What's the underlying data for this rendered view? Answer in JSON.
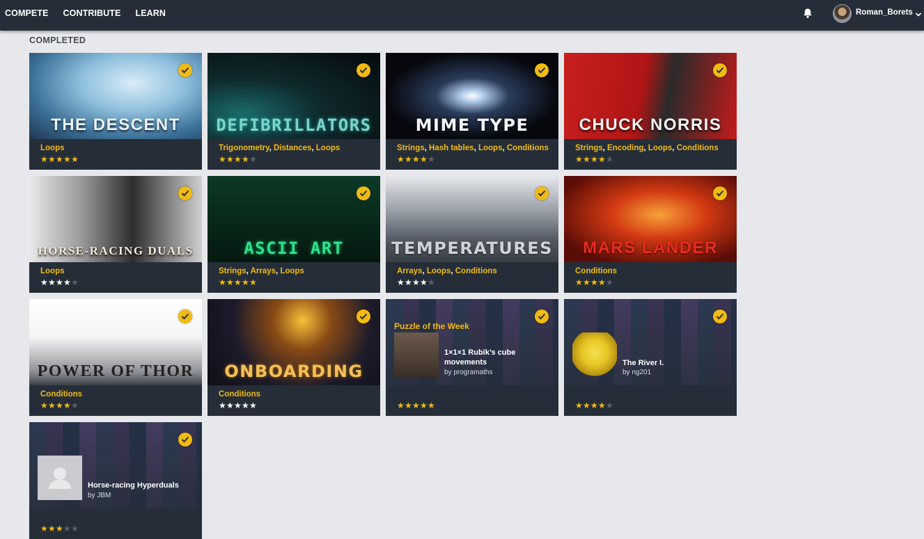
{
  "nav": {
    "items": [
      "COMPETE",
      "CONTRIBUTE",
      "LEARN"
    ]
  },
  "user": {
    "name": "Roman_Borets"
  },
  "section": {
    "title": "COMPLETED"
  },
  "icons": {
    "notifications": "bell-icon",
    "menu": "chevron-down-icon",
    "completed": "check-icon",
    "star": "star-icon"
  },
  "colors": {
    "accent": "#f2bb13",
    "topbar": "#252e38",
    "card": "#252e38",
    "page": "#e7e8eb"
  },
  "puzzles": [
    {
      "title": "THE DESCENT",
      "tags": [
        "Loops"
      ],
      "rating": 5,
      "star_color": "yellow",
      "completed": true
    },
    {
      "title": "DEFIBRILLATORS",
      "tags": [
        "Trigonometry",
        "Distances",
        "Loops"
      ],
      "rating": 4,
      "star_color": "yellow",
      "completed": true
    },
    {
      "title": "MIME TYPE",
      "tags": [
        "Strings",
        "Hash tables",
        "Loops",
        "Conditions"
      ],
      "rating": 4,
      "star_color": "yellow",
      "completed": true
    },
    {
      "title": "CHUCK NORRIS",
      "tags": [
        "Strings",
        "Encoding",
        "Loops",
        "Conditions"
      ],
      "rating": 4,
      "star_color": "yellow",
      "completed": true
    },
    {
      "title": "HORSE-RACING DUALS",
      "tags": [
        "Loops"
      ],
      "rating": 4,
      "star_color": "white",
      "completed": true
    },
    {
      "title": "ASCII ART",
      "tags": [
        "Strings",
        "Arrays",
        "Loops"
      ],
      "rating": 5,
      "star_color": "yellow",
      "completed": true
    },
    {
      "title": "TEMPERATURES",
      "tags": [
        "Arrays",
        "Loops",
        "Conditions"
      ],
      "rating": 4,
      "star_color": "white",
      "completed": true
    },
    {
      "title": "MARS LANDER",
      "tags": [
        "Conditions"
      ],
      "rating": 4,
      "star_color": "yellow",
      "completed": true
    },
    {
      "title": "POWER OF THOR",
      "tags": [
        "Conditions"
      ],
      "rating": 4,
      "star_color": "yellow",
      "completed": true
    },
    {
      "title": "ONBOARDING",
      "tags": [
        "Conditions"
      ],
      "rating": 5,
      "star_color": "white",
      "completed": true
    }
  ],
  "community": [
    {
      "badge": "Puzzle of the Week",
      "title_lines": [
        "1×1×1 Rubik’s cube",
        "movements"
      ],
      "author": "by programaths",
      "rating": 5,
      "completed": true
    },
    {
      "badge": "",
      "title_lines": [
        "The River I."
      ],
      "author": "by ng201",
      "rating": 4,
      "completed": true
    },
    {
      "badge": "",
      "title_lines": [
        "Horse-racing Hyperduals"
      ],
      "author": "by JBM",
      "rating": 3,
      "completed": true
    }
  ]
}
